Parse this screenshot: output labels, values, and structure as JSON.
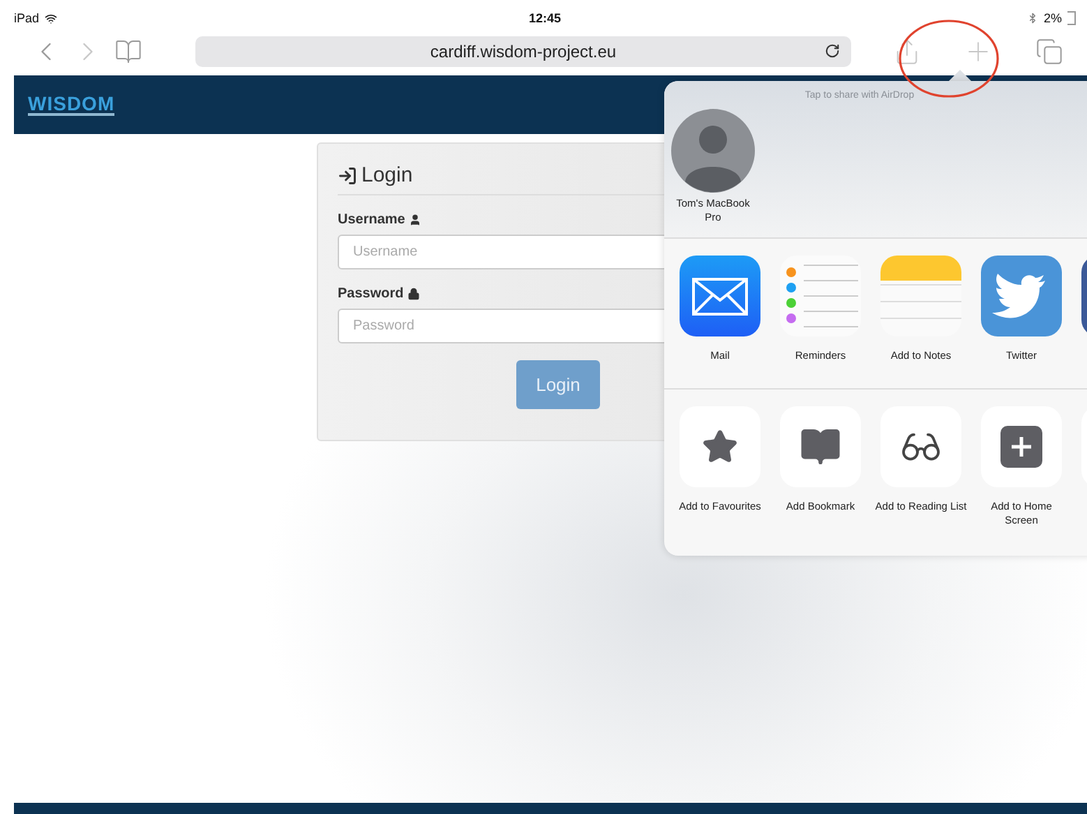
{
  "status_bar": {
    "device": "iPad",
    "time": "12:45",
    "battery": "2%"
  },
  "toolbar": {
    "url": "cardiff.wisdom-project.eu"
  },
  "site": {
    "logo": "WISDOM"
  },
  "login": {
    "title": "Login",
    "button": "Login",
    "fields": [
      {
        "label": "Username",
        "placeholder": "Username",
        "kind": "user"
      },
      {
        "label": "Password",
        "placeholder": "Password",
        "kind": "lock"
      }
    ]
  },
  "share_sheet": {
    "airdrop_hint": "Tap to share with AirDrop",
    "devices": [
      {
        "name": "Tom's MacBook Pro"
      }
    ],
    "apps": [
      {
        "label": "Mail",
        "kind": "mail"
      },
      {
        "label": "Reminders",
        "kind": "reminders"
      },
      {
        "label": "Add to Notes",
        "kind": "notes"
      },
      {
        "label": "Twitter",
        "kind": "twitter"
      },
      {
        "kind": "partial_app"
      }
    ],
    "actions": [
      {
        "label": "Add to Favourites",
        "kind": "star"
      },
      {
        "label": "Add Bookmark",
        "kind": "book"
      },
      {
        "label": "Add to Reading List",
        "kind": "glasses"
      },
      {
        "label": "Add to Home Screen",
        "kind": "plus"
      },
      {
        "kind": "partial_action"
      }
    ]
  }
}
